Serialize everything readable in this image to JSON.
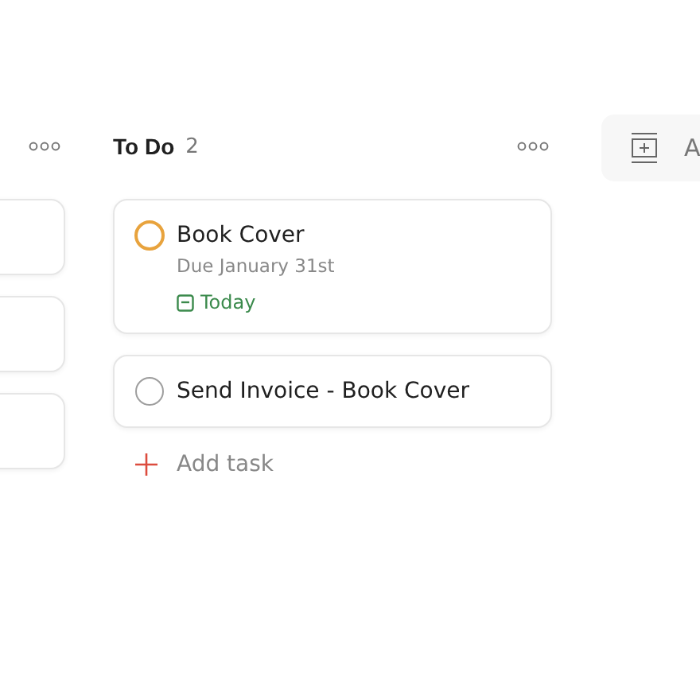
{
  "columns": [
    {
      "cards": [
        {
          "kind": "blank"
        },
        {
          "kind": "blank"
        },
        {
          "kind": "blank"
        }
      ]
    },
    {
      "title": "To Do",
      "count": "2",
      "cards": [
        {
          "kind": "task",
          "title": "Book Cover",
          "color": "#e8a33d",
          "due": "Due January 31st",
          "date": "Today"
        },
        {
          "kind": "task",
          "title": "Send Invoice - Book Cover",
          "color": "#9e9e9e"
        }
      ],
      "add_task": "Add task"
    }
  ],
  "add_section": {
    "label": "A"
  }
}
